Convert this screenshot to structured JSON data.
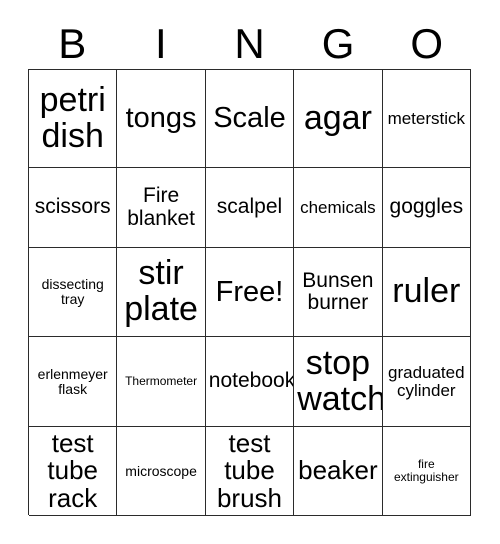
{
  "card": {
    "header": {
      "letters": [
        "B",
        "I",
        "N",
        "G",
        "O"
      ]
    },
    "grid": {
      "columns": 5,
      "rows": 5,
      "cells": [
        {
          "text": "petri dish",
          "size": "xxl"
        },
        {
          "text": "tongs",
          "size": "xl"
        },
        {
          "text": "Scale",
          "size": "xl"
        },
        {
          "text": "agar",
          "size": "xxl"
        },
        {
          "text": "meterstick",
          "size": "sm"
        },
        {
          "text": "scissors",
          "size": "md"
        },
        {
          "text": "Fire blanket",
          "size": "md"
        },
        {
          "text": "scalpel",
          "size": "md"
        },
        {
          "text": "chemicals",
          "size": "sm"
        },
        {
          "text": "goggles",
          "size": "md"
        },
        {
          "text": "dissecting tray",
          "size": "xs"
        },
        {
          "text": "stir plate",
          "size": "xxl"
        },
        {
          "text": "Free!",
          "size": "xl"
        },
        {
          "text": "Bunsen burner",
          "size": "md"
        },
        {
          "text": "ruler",
          "size": "xxl"
        },
        {
          "text": "erlenmeyer flask",
          "size": "xs"
        },
        {
          "text": "Thermometer",
          "size": "xxs"
        },
        {
          "text": "notebook",
          "size": "md"
        },
        {
          "text": "stop watch",
          "size": "xxl"
        },
        {
          "text": "graduated cylinder",
          "size": "sm"
        },
        {
          "text": "test tube rack",
          "size": "lg"
        },
        {
          "text": "microscope",
          "size": "xs"
        },
        {
          "text": "test tube brush",
          "size": "lg"
        },
        {
          "text": "beaker",
          "size": "lg"
        },
        {
          "text": "fire extinguisher",
          "size": "xxs"
        }
      ]
    },
    "colors": {
      "background": "#ffffff",
      "border": "#2b2b2b",
      "text": "#000000"
    }
  }
}
